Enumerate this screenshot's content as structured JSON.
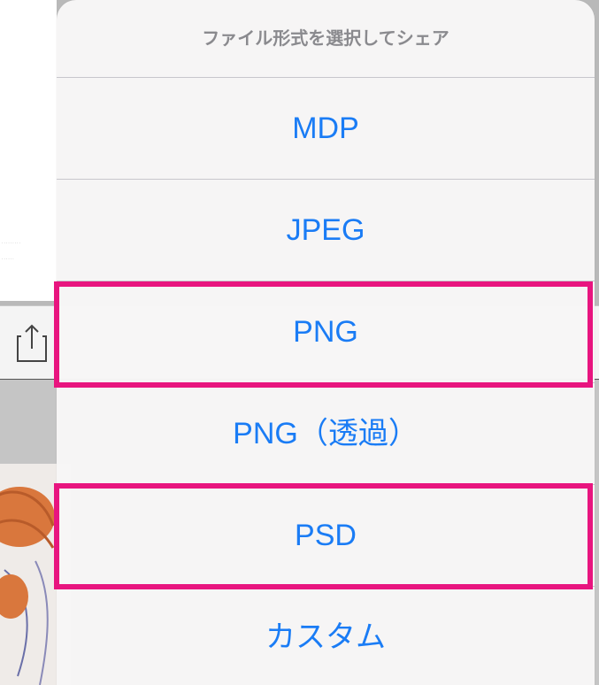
{
  "share_sheet": {
    "title": "ファイル形式を選択してシェア",
    "options": [
      {
        "label": "MDP"
      },
      {
        "label": "JPEG"
      },
      {
        "label": "PNG",
        "highlighted": true
      },
      {
        "label": "PNG（透過）"
      },
      {
        "label": "PSD",
        "highlighted": true
      },
      {
        "label": "カスタム"
      }
    ]
  },
  "background": {
    "share_icon": "share-icon"
  },
  "colors": {
    "option_text": "#1a7cf5",
    "title_text": "#8a8a8e",
    "highlight": "#e8157f"
  }
}
